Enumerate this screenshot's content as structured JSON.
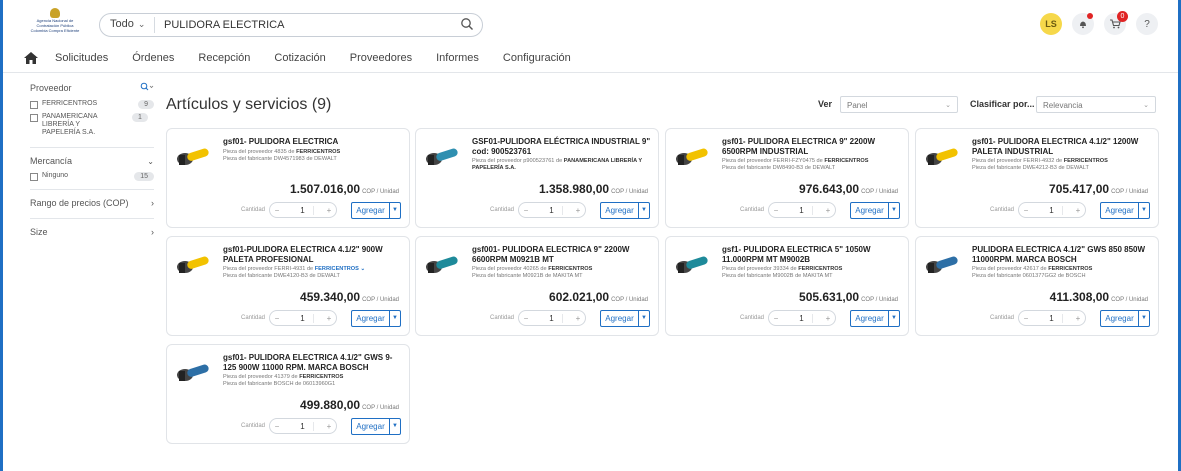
{
  "header": {
    "logo_text": "Agencia Nacional de Contratación Pública Colombia Compra Eficiente",
    "search_scope": "Todo",
    "search_value": "PULIDORA ELECTRICA",
    "user_initials": "LS",
    "cart_count": "0",
    "help_label": "?"
  },
  "nav": {
    "items": [
      "Solicitudes",
      "Órdenes",
      "Recepción",
      "Cotización",
      "Proveedores",
      "Informes",
      "Configuración"
    ]
  },
  "sidebar": {
    "proveedor_label": "Proveedor",
    "proveedor_items": [
      {
        "label": "FERRICENTROS",
        "count": "9"
      },
      {
        "label": "PANAMERICANA LIBRERÍA Y PAPELERÍA S.A.",
        "count": "1"
      }
    ],
    "mercancia_label": "Mercancía",
    "mercancia_items": [
      {
        "label": "Ninguno",
        "count": "15"
      }
    ],
    "rango_label": "Rango de precios (COP)",
    "size_label": "Size"
  },
  "main": {
    "title": "Artículos y servicios (9)",
    "ver_label": "Ver",
    "ver_value": "Panel",
    "clasificar_label": "Clasificar por...",
    "clasificar_value": "Relevancia",
    "unit_label": "COP / Unidad",
    "qty_label": "Cantidad",
    "add_label": "Agregar"
  },
  "products": [
    {
      "title": "gsf01- PULIDORA ELECTRICA",
      "prov_prefix": "Pieza del proveedor 4835 de",
      "prov": "FERRICENTROS",
      "fab": "Pieza del fabricante DW4571983 de DEWALT",
      "price": "1.507.016,00",
      "qty": "1",
      "color": "#f2c200"
    },
    {
      "title": "GSF01-PULIDORA ELÉCTRICA INDUSTRIAL 9\" cod: 900523761",
      "prov_prefix": "Pieza del proveedor p900523761 de",
      "prov": "PANAMERICANA LIBRERÍA Y PAPELERÍA S.A.",
      "fab": "",
      "price": "1.358.980,00",
      "qty": "1",
      "color": "#2f8fb0"
    },
    {
      "title": "gsf01- PULIDORA ELECTRICA 9\" 2200W 6500RPM INDUSTRIAL",
      "prov_prefix": "Pieza del proveedor FERRI-FZY0475 de",
      "prov": "FERRICENTROS",
      "fab": "Pieza del fabricante DW8490-B3 de DEWALT",
      "price": "976.643,00",
      "qty": "1",
      "color": "#f2c200"
    },
    {
      "title": "gsf01- PULIDORA ELECTRICA 4.1/2\" 1200W PALETA INDUSTRIAL",
      "prov_prefix": "Pieza del proveedor FERRI-4932 de",
      "prov": "FERRICENTROS",
      "fab": "Pieza del fabricante DWE4212-B3 de DEWALT",
      "price": "705.417,00",
      "qty": "1",
      "color": "#f2c200"
    },
    {
      "title": "gsf01-PULIDORA ELECTRICA 4.1/2\" 900W PALETA PROFESIONAL",
      "prov_prefix": "Pieza del proveedor FERRI-4931 de",
      "prov": "FERRICENTROS",
      "fab": "Pieza del fabricante DWE4120-B3 de DEWALT",
      "price": "459.340,00",
      "qty": "1",
      "color": "#f2c200"
    },
    {
      "title": "gsf001- PULIDORA ELECTRICA 9\" 2200W 6600RPM M0921B MT",
      "prov_prefix": "Pieza del proveedor 40265 de",
      "prov": "FERRICENTROS",
      "fab": "Pieza del fabricante M0921B de MAKITA MT",
      "price": "602.021,00",
      "qty": "1",
      "color": "#1e8a9a"
    },
    {
      "title": "gsf1- PULIDORA ELECTRICA 5\" 1050W 11.000RPM MT M9002B",
      "prov_prefix": "Pieza del proveedor 39334 de",
      "prov": "FERRICENTROS",
      "fab": "Pieza del fabricante M9002B de MAKITA MT",
      "price": "505.631,00",
      "qty": "1",
      "color": "#1e8a9a"
    },
    {
      "title": "PULIDORA ELECTRICA 4.1/2\" GWS 850 850W 11000RPM. MARCA BOSCH",
      "prov_prefix": "Pieza del proveedor 42617 de",
      "prov": "FERRICENTROS",
      "fab": "Pieza del fabricante 0601377GG2 de BOSCH",
      "price": "411.308,00",
      "qty": "1",
      "color": "#2d6fa6"
    },
    {
      "title": "gsf01- PULIDORA ELECTRICA 4.1/2\" GWS 9-125 900W 11000 RPM. MARCA BOSCH",
      "prov_prefix": "Pieza del proveedor 41379 de",
      "prov": "FERRICENTROS",
      "fab": "Pieza del fabricante BOSCH de 06013960G1",
      "price": "499.880,00",
      "qty": "1",
      "color": "#2d6fa6"
    }
  ]
}
